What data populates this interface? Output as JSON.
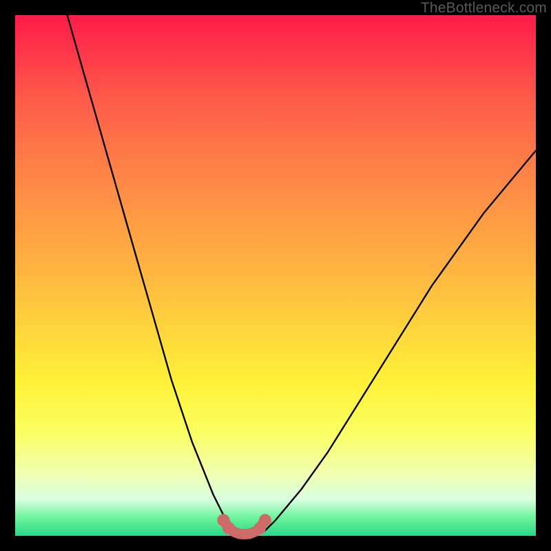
{
  "watermark": "TheBottleneck.com",
  "chart_data": {
    "type": "line",
    "title": "",
    "xlabel": "",
    "ylabel": "",
    "xlim": [
      0,
      100
    ],
    "ylim": [
      0,
      100
    ],
    "series": [
      {
        "name": "bottleneck-curve",
        "x": [
          10,
          12,
          14,
          16,
          18,
          20,
          22,
          24,
          26,
          28,
          30,
          32,
          34,
          36,
          38,
          40,
          42,
          44,
          46,
          48,
          50,
          55,
          60,
          65,
          70,
          75,
          80,
          85,
          90,
          95,
          100
        ],
        "y": [
          100,
          93,
          86,
          79,
          72,
          65,
          58,
          51,
          44,
          37,
          30,
          24,
          18,
          13,
          8,
          4,
          1,
          0,
          0,
          1,
          3,
          9,
          16,
          24,
          32,
          40,
          48,
          55,
          62,
          68,
          74
        ]
      }
    ],
    "highlight_segment": {
      "name": "valley-marker",
      "color": "#cf6a6a",
      "x": [
        40,
        41,
        42,
        43,
        44,
        45,
        46,
        47,
        48
      ],
      "y": [
        3,
        1.5,
        0.8,
        0.4,
        0.3,
        0.4,
        0.8,
        1.5,
        3
      ]
    }
  }
}
